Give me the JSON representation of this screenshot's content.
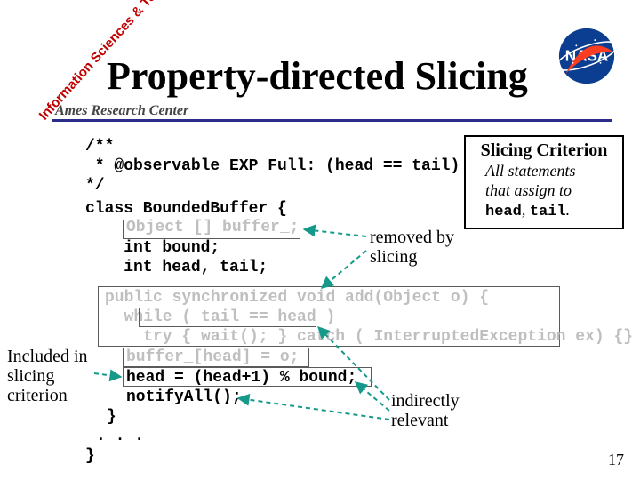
{
  "watermark": "Information Sciences & Technology",
  "title": "Property-directed Slicing",
  "ames": "Ames Research Center",
  "logo_name": "nasa-logo",
  "code": {
    "block1": "/**\n * @observable EXP Full: (head == tail)\n*/",
    "block2": "class BoundedBuffer {\n\n    int bound;\n    int head, tail;",
    "removed_decl": "Object [] buffer_;",
    "add_removed": "public synchronized void add(Object o) {\n  while ( tail == head )\n    try { wait(); } catch ( InterruptedException ex) {}",
    "inner_cond": "tail == head",
    "buf_removed": "buffer_[head] = o;",
    "head_assign": "head = (head+1) % bound;",
    "notify": "notifyAll();",
    "brace_close": "}",
    "dots": ". . .",
    "class_close": "}"
  },
  "criterion": {
    "title": "Slicing Criterion",
    "body_1": "All statements",
    "body_2": "that assign to",
    "body_3a": "head",
    "body_3b": "tail",
    "body_3_sep": ", ",
    "body_3_end": "."
  },
  "labels": {
    "removed": "removed by\nslicing",
    "indirect": "indirectly\nrelevant",
    "included": "Included in\nslicing\ncriterion"
  },
  "page_number": "17",
  "colors": {
    "accent": "#2b2b8a",
    "removed": "#bfbfbf",
    "arrow": "#15998a"
  }
}
